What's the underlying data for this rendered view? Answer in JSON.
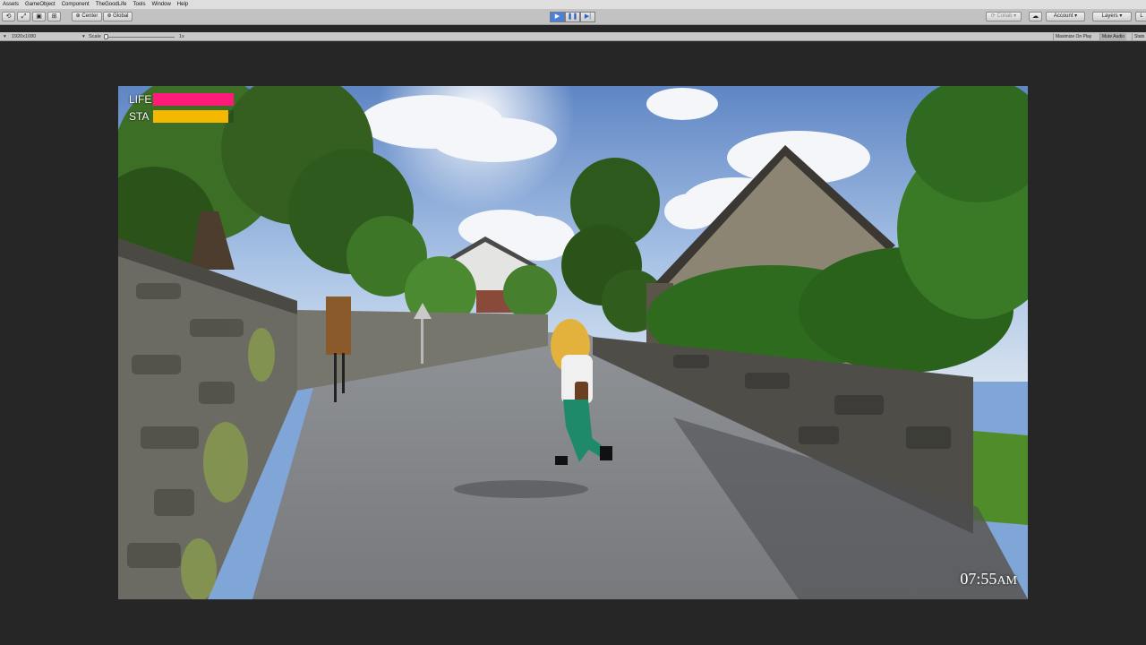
{
  "menu": [
    "Assets",
    "GameObject",
    "Component",
    "TheGoodLife",
    "Tools",
    "Window",
    "Help"
  ],
  "toolbar": {
    "pivot_label": "Center",
    "space_label": "Global",
    "collab_label": "Collab",
    "account_label": "Account",
    "layers_label": "Layers"
  },
  "gamebar": {
    "resolution": "1920x1080",
    "scale_label": "Scale",
    "scale_value": "1x",
    "maximize_on_play": "Maximize On Play",
    "mute_audio": "Mute Audio",
    "stats": "Stats"
  },
  "hud": {
    "life_label": "LIFE",
    "life_level": 1.0,
    "life_color": "#ff1a7a",
    "stamina_label": "STA",
    "stamina_level": 0.93,
    "stamina_color": "#f5b800",
    "clock_time": "07:55",
    "clock_ampm": "AM"
  },
  "colors": {
    "editor_bg": "#262626",
    "play_active": "#4c7fd8"
  }
}
